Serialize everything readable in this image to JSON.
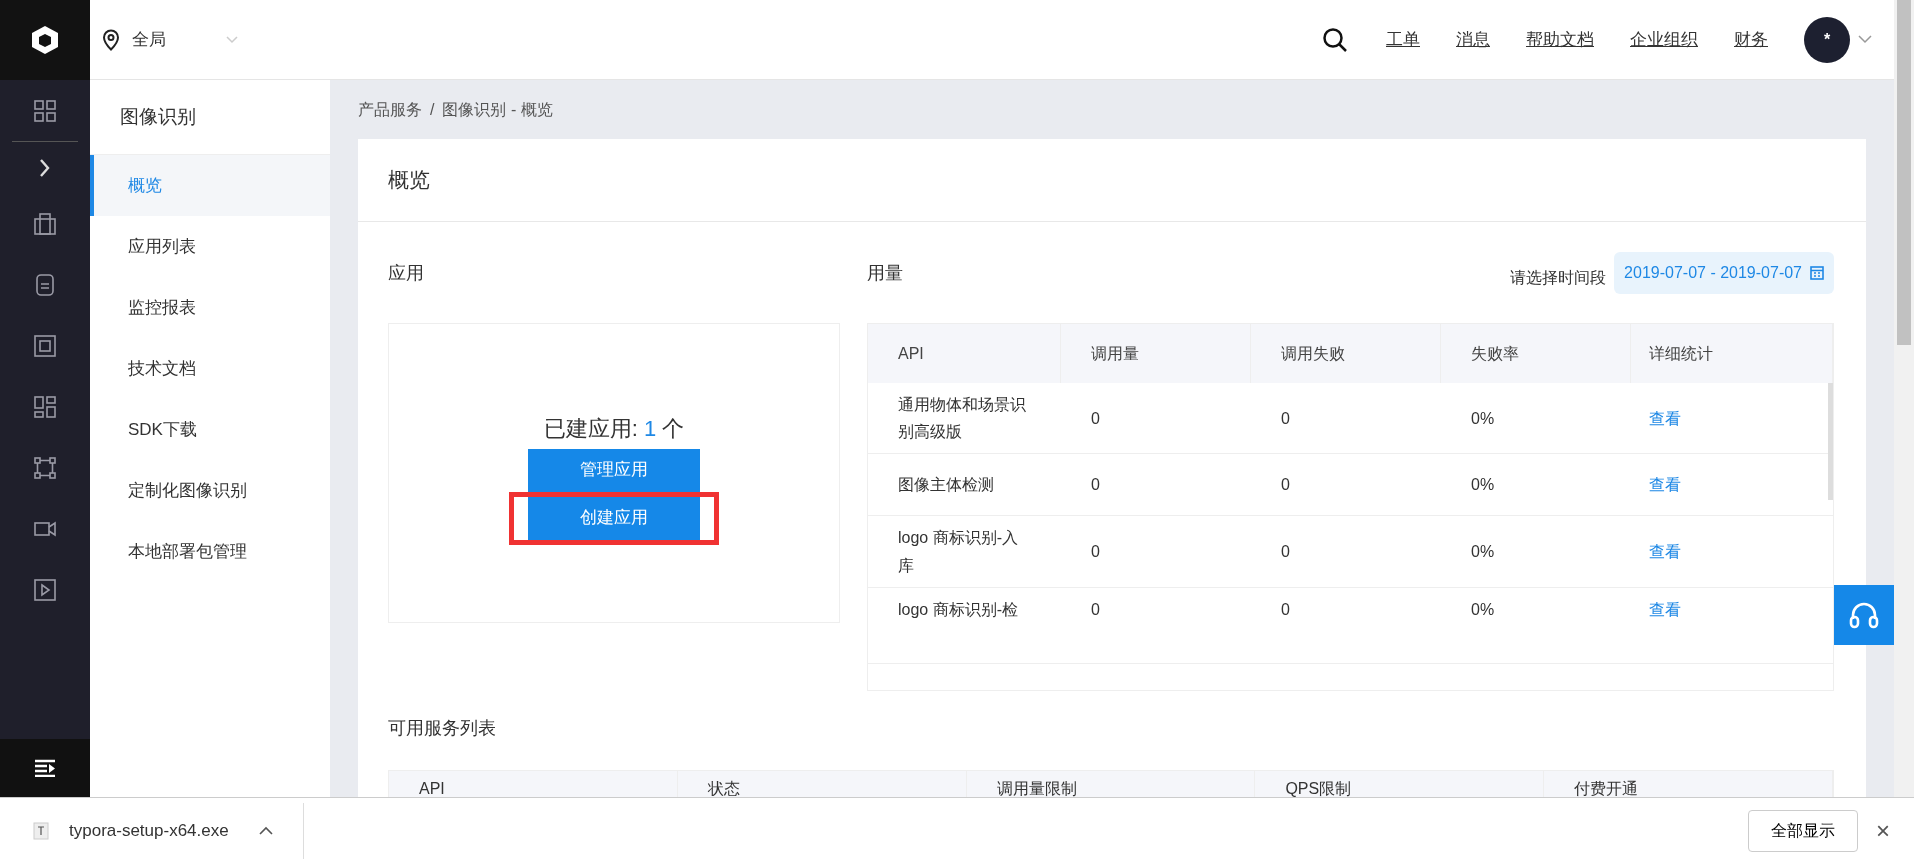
{
  "topbar": {
    "region": "全局",
    "nav": [
      "工单",
      "消息",
      "帮助文档",
      "企业组织",
      "财务"
    ],
    "avatar": "*"
  },
  "sidebar": {
    "title": "图像识别",
    "items": [
      {
        "label": "概览",
        "selected": true
      },
      {
        "label": "应用列表",
        "selected": false
      },
      {
        "label": "监控报表",
        "selected": false
      },
      {
        "label": "技术文档",
        "selected": false
      },
      {
        "label": "SDK下载",
        "selected": false
      },
      {
        "label": "定制化图像识别",
        "selected": false
      },
      {
        "label": "本地部署包管理",
        "selected": false
      }
    ]
  },
  "breadcrumb": {
    "items": [
      "产品服务",
      "图像识别 - 概览"
    ],
    "separator": "/"
  },
  "card": {
    "title": "概览"
  },
  "apps": {
    "title": "应用",
    "count_label": "已建应用:",
    "count": "1",
    "unit": "个",
    "buttons": [
      {
        "label": "管理应用",
        "highlighted": false
      },
      {
        "label": "创建应用",
        "highlighted": true
      }
    ]
  },
  "usage": {
    "title": "用量",
    "period_label": "请选择时间段",
    "period": "2019-07-07 - 2019-07-07",
    "columns": [
      "API",
      "调用量",
      "调用失败",
      "失败率",
      "详细统计"
    ],
    "rows": [
      {
        "api": "通用物体和场景识别高级版",
        "calls": "0",
        "failures": "0",
        "rate": "0%",
        "link": "查看"
      },
      {
        "api": "图像主体检测",
        "calls": "0",
        "failures": "0",
        "rate": "0%",
        "link": "查看"
      },
      {
        "api": "logo 商标识别-入库",
        "calls": "0",
        "failures": "0",
        "rate": "0%",
        "link": "查看"
      },
      {
        "api": "logo 商标识别-检",
        "calls": "0",
        "failures": "0",
        "rate": "0%",
        "link": "查看"
      }
    ]
  },
  "services": {
    "title": "可用服务列表",
    "columns": [
      "API",
      "状态",
      "调用量限制",
      "QPS限制",
      "付费开通"
    ]
  },
  "download_bar": {
    "file": "typora-setup-x64.exe",
    "show_all": "全部显示",
    "close": "×"
  }
}
